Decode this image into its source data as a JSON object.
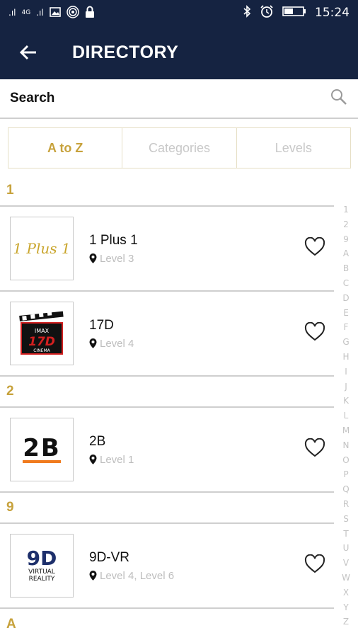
{
  "status_bar": {
    "time": "15:24",
    "signal_1": ".ıl",
    "network_type": "4G",
    "signal_2": ".ıl"
  },
  "app_bar": {
    "title": "DIRECTORY"
  },
  "search": {
    "label": "Search"
  },
  "tabs": [
    {
      "label": "A to Z",
      "active": true
    },
    {
      "label": "Categories",
      "active": false
    },
    {
      "label": "Levels",
      "active": false
    }
  ],
  "sections": [
    {
      "header": "1",
      "items": [
        {
          "name": "1 Plus 1",
          "level": "Level 3",
          "logo_text": "1 Plus 1"
        },
        {
          "name": "17D",
          "level": "Level 4",
          "logo_text": "IMAX 17D CINEMA"
        }
      ]
    },
    {
      "header": "2",
      "items": [
        {
          "name": "2B",
          "level": "Level 1",
          "logo_text": "2B"
        }
      ]
    },
    {
      "header": "9",
      "items": [
        {
          "name": "9D-VR",
          "level": "Level 4, Level 6",
          "logo_text": "9D VIRTUAL REALITY"
        }
      ]
    },
    {
      "header": "A",
      "items": []
    }
  ],
  "logos": {
    "imax_top": "IMAX",
    "imax_mid": "17D",
    "imax_bottom": "CINEMA",
    "nine_d_top": "9D",
    "nine_d_l1": "VIRTUAL",
    "nine_d_l2": "REALITY"
  },
  "alpha_index": [
    "1",
    "2",
    "9",
    "A",
    "B",
    "C",
    "D",
    "E",
    "F",
    "G",
    "H",
    "I",
    "J",
    "K",
    "L",
    "M",
    "N",
    "O",
    "P",
    "Q",
    "R",
    "S",
    "T",
    "U",
    "V",
    "W",
    "X",
    "Y",
    "Z"
  ],
  "colors": {
    "header_bg": "#152341",
    "accent_gold": "#c7a23c",
    "muted": "#bdbdbd"
  }
}
